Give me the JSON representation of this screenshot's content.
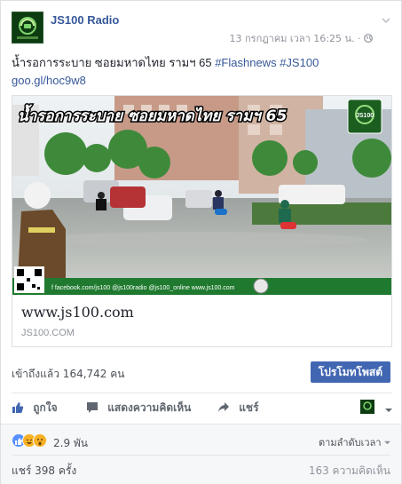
{
  "post": {
    "page_name": "JS100 Radio",
    "timestamp": "13 กรกฎาคม เวลา 16:25 น.",
    "separator": "·",
    "text_main": "น้ำรอการระบาย ซอยมหาดไทย รามฯ 65",
    "hashtag_1": "#Flashnews",
    "hashtag_2": "#JS100",
    "short_link": "goo.gl/hoc9w8"
  },
  "link_card": {
    "image_banner": "น้ำรอการระบาย ซอยมหาดไทย รามฯ 65",
    "image_footer": "f facebook.com/js100   @js100radio   @js100_online   www.js100.com",
    "title": "www.js100.com",
    "domain": "JS100.COM"
  },
  "stats": {
    "reach": "เข้าถึงแล้ว 164,742 คน",
    "boost_label": "โปรโมทโพสต์"
  },
  "actions": {
    "like": "ถูกใจ",
    "comment": "แสดงความคิดเห็น",
    "share": "แชร์"
  },
  "footer": {
    "reaction_count": "2.9 พัน",
    "sort_label": "ตามลำดับเวลา",
    "shares": "แชร์ 398 ครั้ง",
    "comments": "163 ความคิดเห็น"
  },
  "colors": {
    "link": "#365899",
    "boost": "#4267b2",
    "like": "#5890ff",
    "haha": "#f7b125",
    "meta": "#90949c"
  },
  "icons": {
    "like": "thumbs-up-icon",
    "comment": "speech-bubble-icon",
    "share": "share-arrow-icon",
    "globe": "globe-icon",
    "chevron": "chevron-down-icon"
  }
}
